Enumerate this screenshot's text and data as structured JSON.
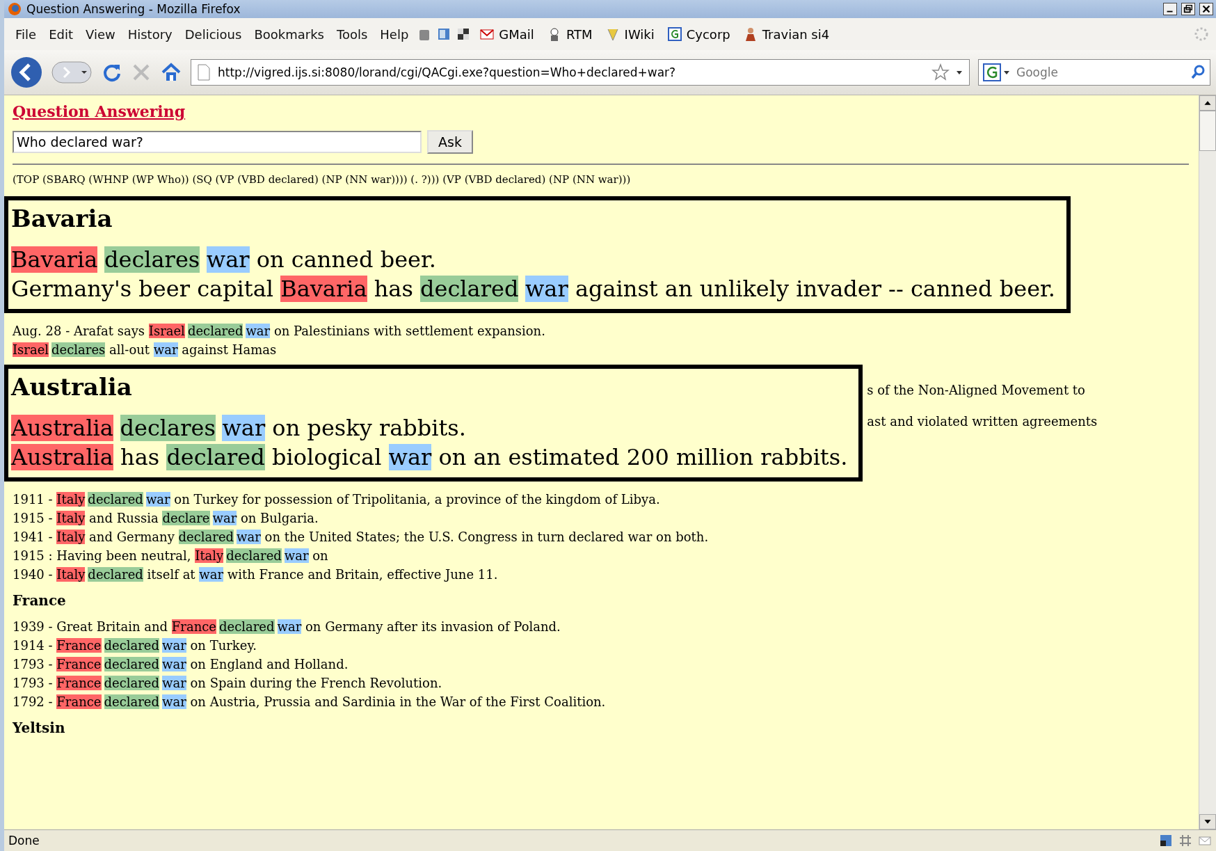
{
  "window": {
    "title": "Question Answering - Mozilla Firefox"
  },
  "menu": [
    "File",
    "Edit",
    "View",
    "History",
    "Delicious",
    "Bookmarks",
    "Tools",
    "Help"
  ],
  "bookmarks": [
    "GMail",
    "RTM",
    "IWiki",
    "Cycorp",
    "Travian si4"
  ],
  "address_bar": {
    "value": "http://vigred.ijs.si:8080/lorand/cgi/QACgi.exe?question=Who+declared+war?"
  },
  "search": {
    "placeholder": "Google"
  },
  "page": {
    "heading": "Question Answering",
    "question": {
      "value": "Who declared war?"
    },
    "ask_button": "Ask",
    "parse": "(TOP (SBARQ (WHNP (WP Who)) (SQ (VP (VBD declared) (NP (NN war)))) (. ?))) (VP (VBD declared) (NP (NN war)))",
    "results": [
      {
        "kind": "callout",
        "heading": "Bavaria",
        "lines": [
          [
            {
              "text": "Bavaria",
              "kind": "entity"
            },
            {
              "text": "declares",
              "kind": "verb"
            },
            {
              "text": "war",
              "kind": "noun"
            },
            {
              "text": " on canned beer."
            }
          ],
          [
            {
              "text": "Germany's beer capital "
            },
            {
              "text": "Bavaria",
              "kind": "entity"
            },
            {
              "text": " has "
            },
            {
              "text": "declared",
              "kind": "verb"
            },
            {
              "text": "war",
              "kind": "noun"
            },
            {
              "text": " against an unlikely invader -- canned beer."
            }
          ]
        ]
      },
      {
        "kind": "plain",
        "lines": [
          [
            {
              "text": "Aug. 28 - Arafat says "
            },
            {
              "text": "Israel",
              "kind": "entity"
            },
            {
              "text": "declared",
              "kind": "verb"
            },
            {
              "text": "war",
              "kind": "noun"
            },
            {
              "text": " on Palestinians with settlement expansion."
            }
          ],
          [
            {
              "text": "Israel",
              "kind": "entity"
            },
            {
              "text": "declares",
              "kind": "verb"
            },
            {
              "text": " all-out "
            },
            {
              "text": "war",
              "kind": "noun"
            },
            {
              "text": " against Hamas"
            }
          ]
        ]
      },
      {
        "kind": "callout",
        "heading": "Australia",
        "side_fragments": [
          "s of the Non-Aligned Movement to",
          "ast and violated written agreements"
        ],
        "lines": [
          [
            {
              "text": "Australia",
              "kind": "entity"
            },
            {
              "text": "declares",
              "kind": "verb"
            },
            {
              "text": "war",
              "kind": "noun"
            },
            {
              "text": " on pesky rabbits."
            }
          ],
          [
            {
              "text": "Australia",
              "kind": "entity"
            },
            {
              "text": " has "
            },
            {
              "text": "declared",
              "kind": "verb"
            },
            {
              "text": " biological "
            },
            {
              "text": "war",
              "kind": "noun"
            },
            {
              "text": " on an estimated 200 million rabbits."
            }
          ]
        ]
      },
      {
        "kind": "plain",
        "lines": [
          [
            {
              "text": "1911 - "
            },
            {
              "text": "Italy",
              "kind": "entity"
            },
            {
              "text": "declared",
              "kind": "verb"
            },
            {
              "text": "war",
              "kind": "noun"
            },
            {
              "text": " on Turkey for possession of Tripolitania, a province of the kingdom of Libya."
            }
          ],
          [
            {
              "text": "1915 - "
            },
            {
              "text": "Italy",
              "kind": "entity"
            },
            {
              "text": " and Russia "
            },
            {
              "text": "declare",
              "kind": "verb"
            },
            {
              "text": "war",
              "kind": "noun"
            },
            {
              "text": " on Bulgaria."
            }
          ],
          [
            {
              "text": "1941 - "
            },
            {
              "text": "Italy",
              "kind": "entity"
            },
            {
              "text": " and Germany "
            },
            {
              "text": "declared",
              "kind": "verb"
            },
            {
              "text": "war",
              "kind": "noun"
            },
            {
              "text": " on the United States; the U.S. Congress in turn declared war on both."
            }
          ],
          [
            {
              "text": "1915 : Having been neutral, "
            },
            {
              "text": "Italy",
              "kind": "entity"
            },
            {
              "text": "declared",
              "kind": "verb"
            },
            {
              "text": "war",
              "kind": "noun"
            },
            {
              "text": " on"
            }
          ],
          [
            {
              "text": "1940 - "
            },
            {
              "text": "Italy",
              "kind": "entity"
            },
            {
              "text": "declared",
              "kind": "verb"
            },
            {
              "text": " itself at "
            },
            {
              "text": "war",
              "kind": "noun"
            },
            {
              "text": " with France and Britain, effective June 11."
            }
          ]
        ]
      },
      {
        "kind": "group",
        "heading": "France",
        "lines": [
          [
            {
              "text": "1939 - Great Britain and "
            },
            {
              "text": "France",
              "kind": "entity"
            },
            {
              "text": "declared",
              "kind": "verb"
            },
            {
              "text": "war",
              "kind": "noun"
            },
            {
              "text": " on Germany after its invasion of Poland."
            }
          ],
          [
            {
              "text": "1914 - "
            },
            {
              "text": "France",
              "kind": "entity"
            },
            {
              "text": "declared",
              "kind": "verb"
            },
            {
              "text": "war",
              "kind": "noun"
            },
            {
              "text": " on Turkey."
            }
          ],
          [
            {
              "text": "1793 - "
            },
            {
              "text": "France",
              "kind": "entity"
            },
            {
              "text": "declared",
              "kind": "verb"
            },
            {
              "text": "war",
              "kind": "noun"
            },
            {
              "text": " on England and Holland."
            }
          ],
          [
            {
              "text": "1793 - "
            },
            {
              "text": "France",
              "kind": "entity"
            },
            {
              "text": "declared",
              "kind": "verb"
            },
            {
              "text": "war",
              "kind": "noun"
            },
            {
              "text": " on Spain during the French Revolution."
            }
          ],
          [
            {
              "text": "1792 - "
            },
            {
              "text": "France",
              "kind": "entity"
            },
            {
              "text": "declared",
              "kind": "verb"
            },
            {
              "text": "war",
              "kind": "noun"
            },
            {
              "text": " on Austria, Prussia and Sardinia in the War of the First Coalition."
            }
          ]
        ]
      },
      {
        "kind": "group",
        "heading": "Yeltsin"
      }
    ]
  },
  "status_bar": {
    "text": "Done"
  }
}
